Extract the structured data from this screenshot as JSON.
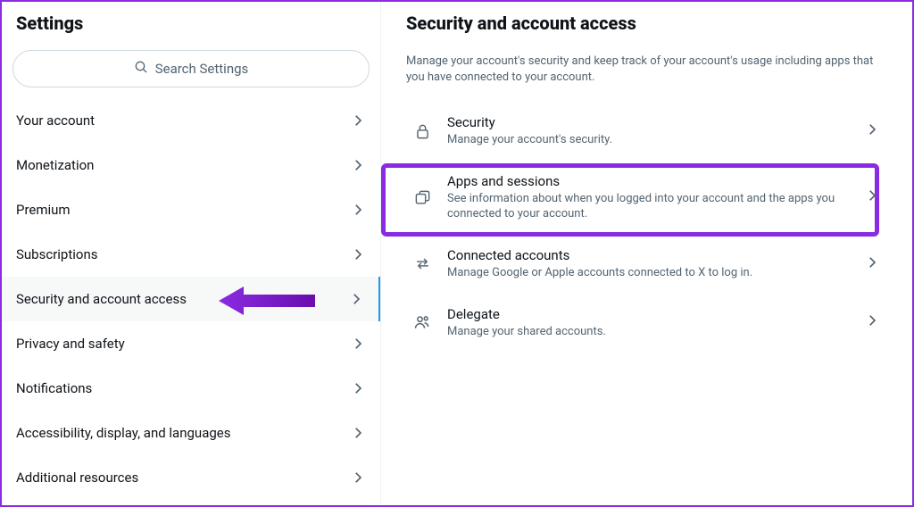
{
  "sidebar": {
    "title": "Settings",
    "search_placeholder": "Search Settings",
    "items": [
      {
        "label": "Your account"
      },
      {
        "label": "Monetization"
      },
      {
        "label": "Premium"
      },
      {
        "label": "Subscriptions"
      },
      {
        "label": "Security and account access"
      },
      {
        "label": "Privacy and safety"
      },
      {
        "label": "Notifications"
      },
      {
        "label": "Accessibility, display, and languages"
      },
      {
        "label": "Additional resources"
      }
    ]
  },
  "main": {
    "title": "Security and account access",
    "description": "Manage your account's security and keep track of your account's usage including apps that you have connected to your account.",
    "options": [
      {
        "title": "Security",
        "desc": "Manage your account's security."
      },
      {
        "title": "Apps and sessions",
        "desc": "See information about when you logged into your account and the apps you connected to your account."
      },
      {
        "title": "Connected accounts",
        "desc": "Manage Google or Apple accounts connected to X to log in."
      },
      {
        "title": "Delegate",
        "desc": "Manage your shared accounts."
      }
    ]
  }
}
